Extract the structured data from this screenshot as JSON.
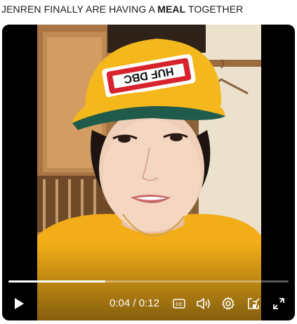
{
  "post": {
    "caption_parts": [
      {
        "text": "JENREN FINALLY ARE HAVING A ",
        "bold": false
      },
      {
        "text": "MEAL",
        "bold": true
      },
      {
        "text": " TOGETHER",
        "bold": false
      }
    ]
  },
  "video": {
    "cap_logo_text": "HUF DBC",
    "current_time": "0:04",
    "separator": " / ",
    "duration": "0:12",
    "progress_fraction": 0.345,
    "cc_label": "CC"
  },
  "icons": {
    "play": "play-icon",
    "captions": "closed-captions-icon",
    "volume": "volume-icon",
    "settings": "gear-icon",
    "miniplayer": "miniplayer-icon",
    "fullscreen": "fullscreen-icon"
  },
  "colors": {
    "cap_yellow": "#f4b81c",
    "shirt_yellow": "#f2ad18",
    "cap_brim_green": "#1f5a4a",
    "logo_red": "#d6232e"
  }
}
